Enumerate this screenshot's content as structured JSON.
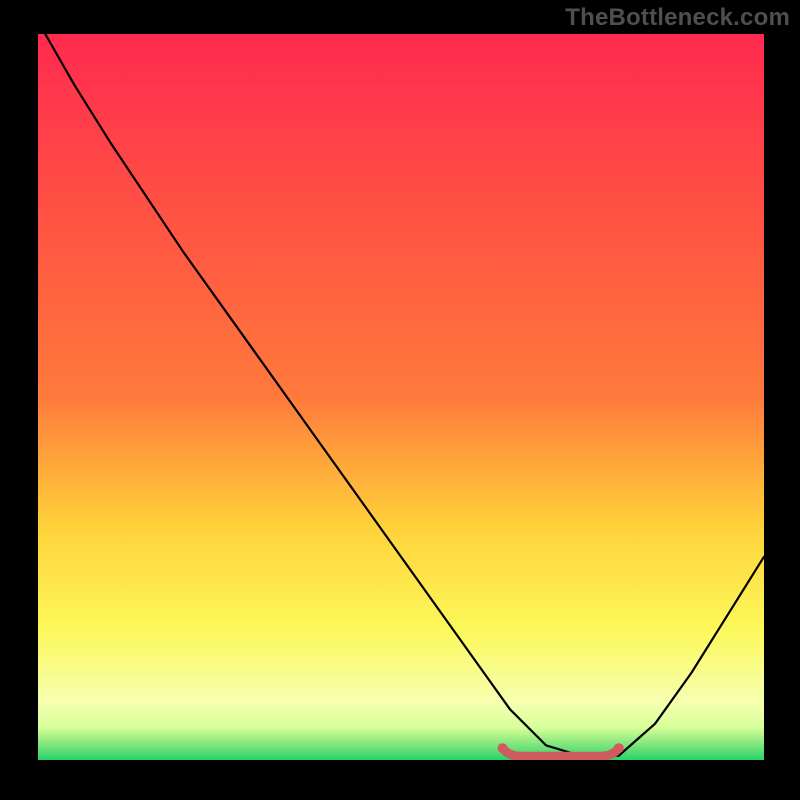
{
  "watermark": "TheBottleneck.com",
  "colors": {
    "frame": "#000000",
    "grad_top": "#ff2a4f",
    "grad_mid1": "#ff7a3c",
    "grad_mid2": "#ffd23a",
    "grad_mid3": "#fcf85a",
    "grad_low": "#f6ffb0",
    "grad_bot": "#27d36a",
    "curve": "#000000",
    "marker": "#cf5b5e"
  },
  "chart_data": {
    "type": "line",
    "title": "",
    "xlabel": "",
    "ylabel": "",
    "xlim": [
      0,
      100
    ],
    "ylim": [
      0,
      100
    ],
    "x": [
      0,
      1,
      5,
      10,
      20,
      30,
      40,
      50,
      60,
      65,
      70,
      75,
      78,
      80,
      85,
      90,
      95,
      100
    ],
    "values": [
      102,
      100,
      93,
      85,
      70,
      56,
      42,
      28,
      14,
      7,
      2,
      0.5,
      0.5,
      0.6,
      5,
      12,
      20,
      28
    ],
    "marker_segment": {
      "x0": 64,
      "x1": 80,
      "y": 0.8
    },
    "annotations": []
  }
}
